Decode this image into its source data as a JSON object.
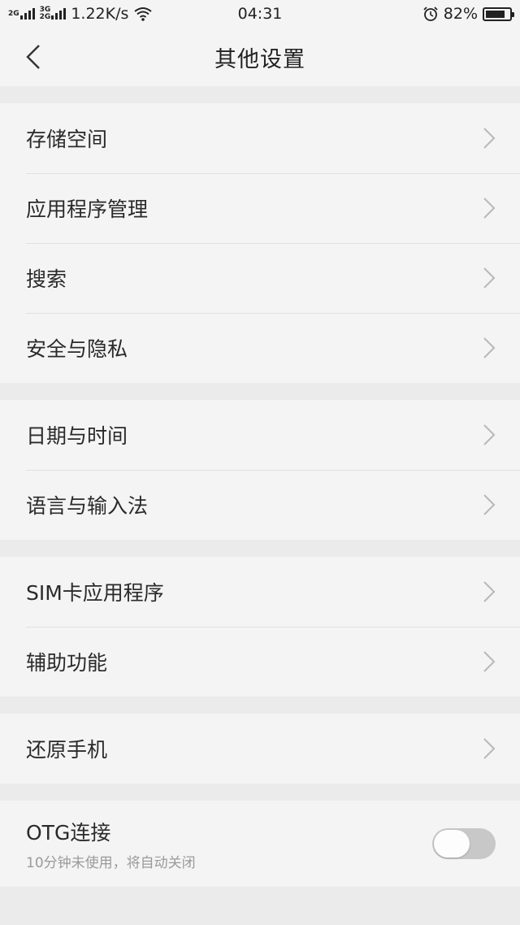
{
  "status_bar": {
    "sim1_label": "2G",
    "sim2_label_top": "3G",
    "sim2_label_bottom": "2G",
    "net_speed": "1.22K/s",
    "time": "04:31",
    "battery": "82%",
    "battery_level": 0.82,
    "icons": [
      "signal-icon",
      "wifi-icon",
      "alarm-icon",
      "battery-icon"
    ]
  },
  "header": {
    "title": "其他设置",
    "back_icon": "back-arrow-icon"
  },
  "groups": [
    {
      "items": [
        {
          "label": "存储空间"
        },
        {
          "label": "应用程序管理"
        },
        {
          "label": "搜索"
        },
        {
          "label": "安全与隐私"
        }
      ]
    },
    {
      "items": [
        {
          "label": "日期与时间"
        },
        {
          "label": "语言与输入法"
        }
      ]
    },
    {
      "items": [
        {
          "label": "SIM卡应用程序"
        },
        {
          "label": "辅助功能"
        }
      ]
    },
    {
      "items": [
        {
          "label": "还原手机"
        }
      ]
    }
  ],
  "otg": {
    "label": "OTG连接",
    "sublabel": "10分钟未使用，将自动关闭",
    "enabled": false
  },
  "colors": {
    "background": "#ebebeb",
    "card": "#f4f4f4",
    "toggle_off": "#c8c8c8"
  }
}
